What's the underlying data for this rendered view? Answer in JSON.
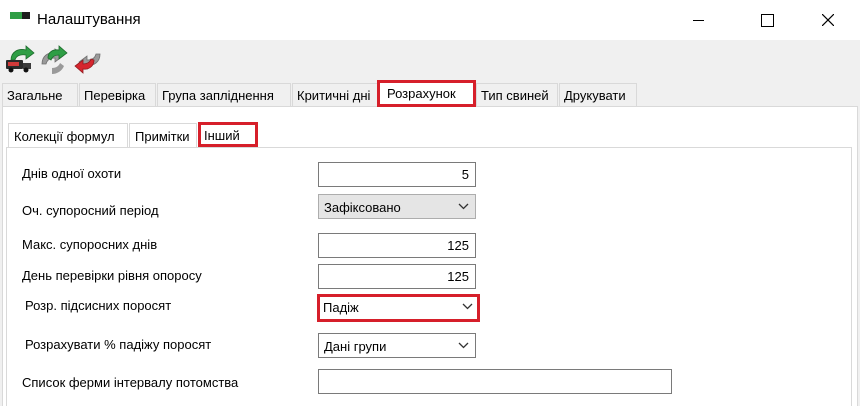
{
  "window": {
    "title": "Налаштування",
    "controls": {
      "minimize": "minimize-icon",
      "maximize": "maximize-icon",
      "close": "close-icon"
    }
  },
  "toolbar": {
    "icons": [
      "truck-green-arrow-icon",
      "grey-green-arrows-icon",
      "red-grey-arrows-icon"
    ]
  },
  "tabs": [
    {
      "label": "Загальне"
    },
    {
      "label": "Перевірка"
    },
    {
      "label": "Група запліднення"
    },
    {
      "label": "Критичні дні"
    },
    {
      "label": "Розрахунок",
      "active": true
    },
    {
      "label": "Тип свиней"
    },
    {
      "label": "Друкувати"
    }
  ],
  "subtabs": [
    {
      "label": "Колекції формул"
    },
    {
      "label": "Примітки"
    },
    {
      "label": "Інший",
      "active": true
    }
  ],
  "form": {
    "days_per_heat": {
      "label": "Днів одної охоти",
      "value": "5"
    },
    "exp_gestation": {
      "label": "Оч. супоросний період",
      "value": "Зафіксовано"
    },
    "max_gestation_days": {
      "label": "Макс. супоросних днів",
      "value": "125"
    },
    "farrow_check_day": {
      "label": "День перевірки рівня опоросу",
      "value": "125"
    },
    "suckling_calc": {
      "label": "Розр. підсисних поросят",
      "value": "Падіж"
    },
    "mortality_calc": {
      "label": "Розрахувати % падіжу поросят",
      "value": "Дані групи"
    },
    "farm_list": {
      "label": "Список ферми інтервалу потомства",
      "value": ""
    }
  },
  "colors": {
    "highlight": "#d61f2a",
    "active_tab_bg": "#ffffff"
  }
}
